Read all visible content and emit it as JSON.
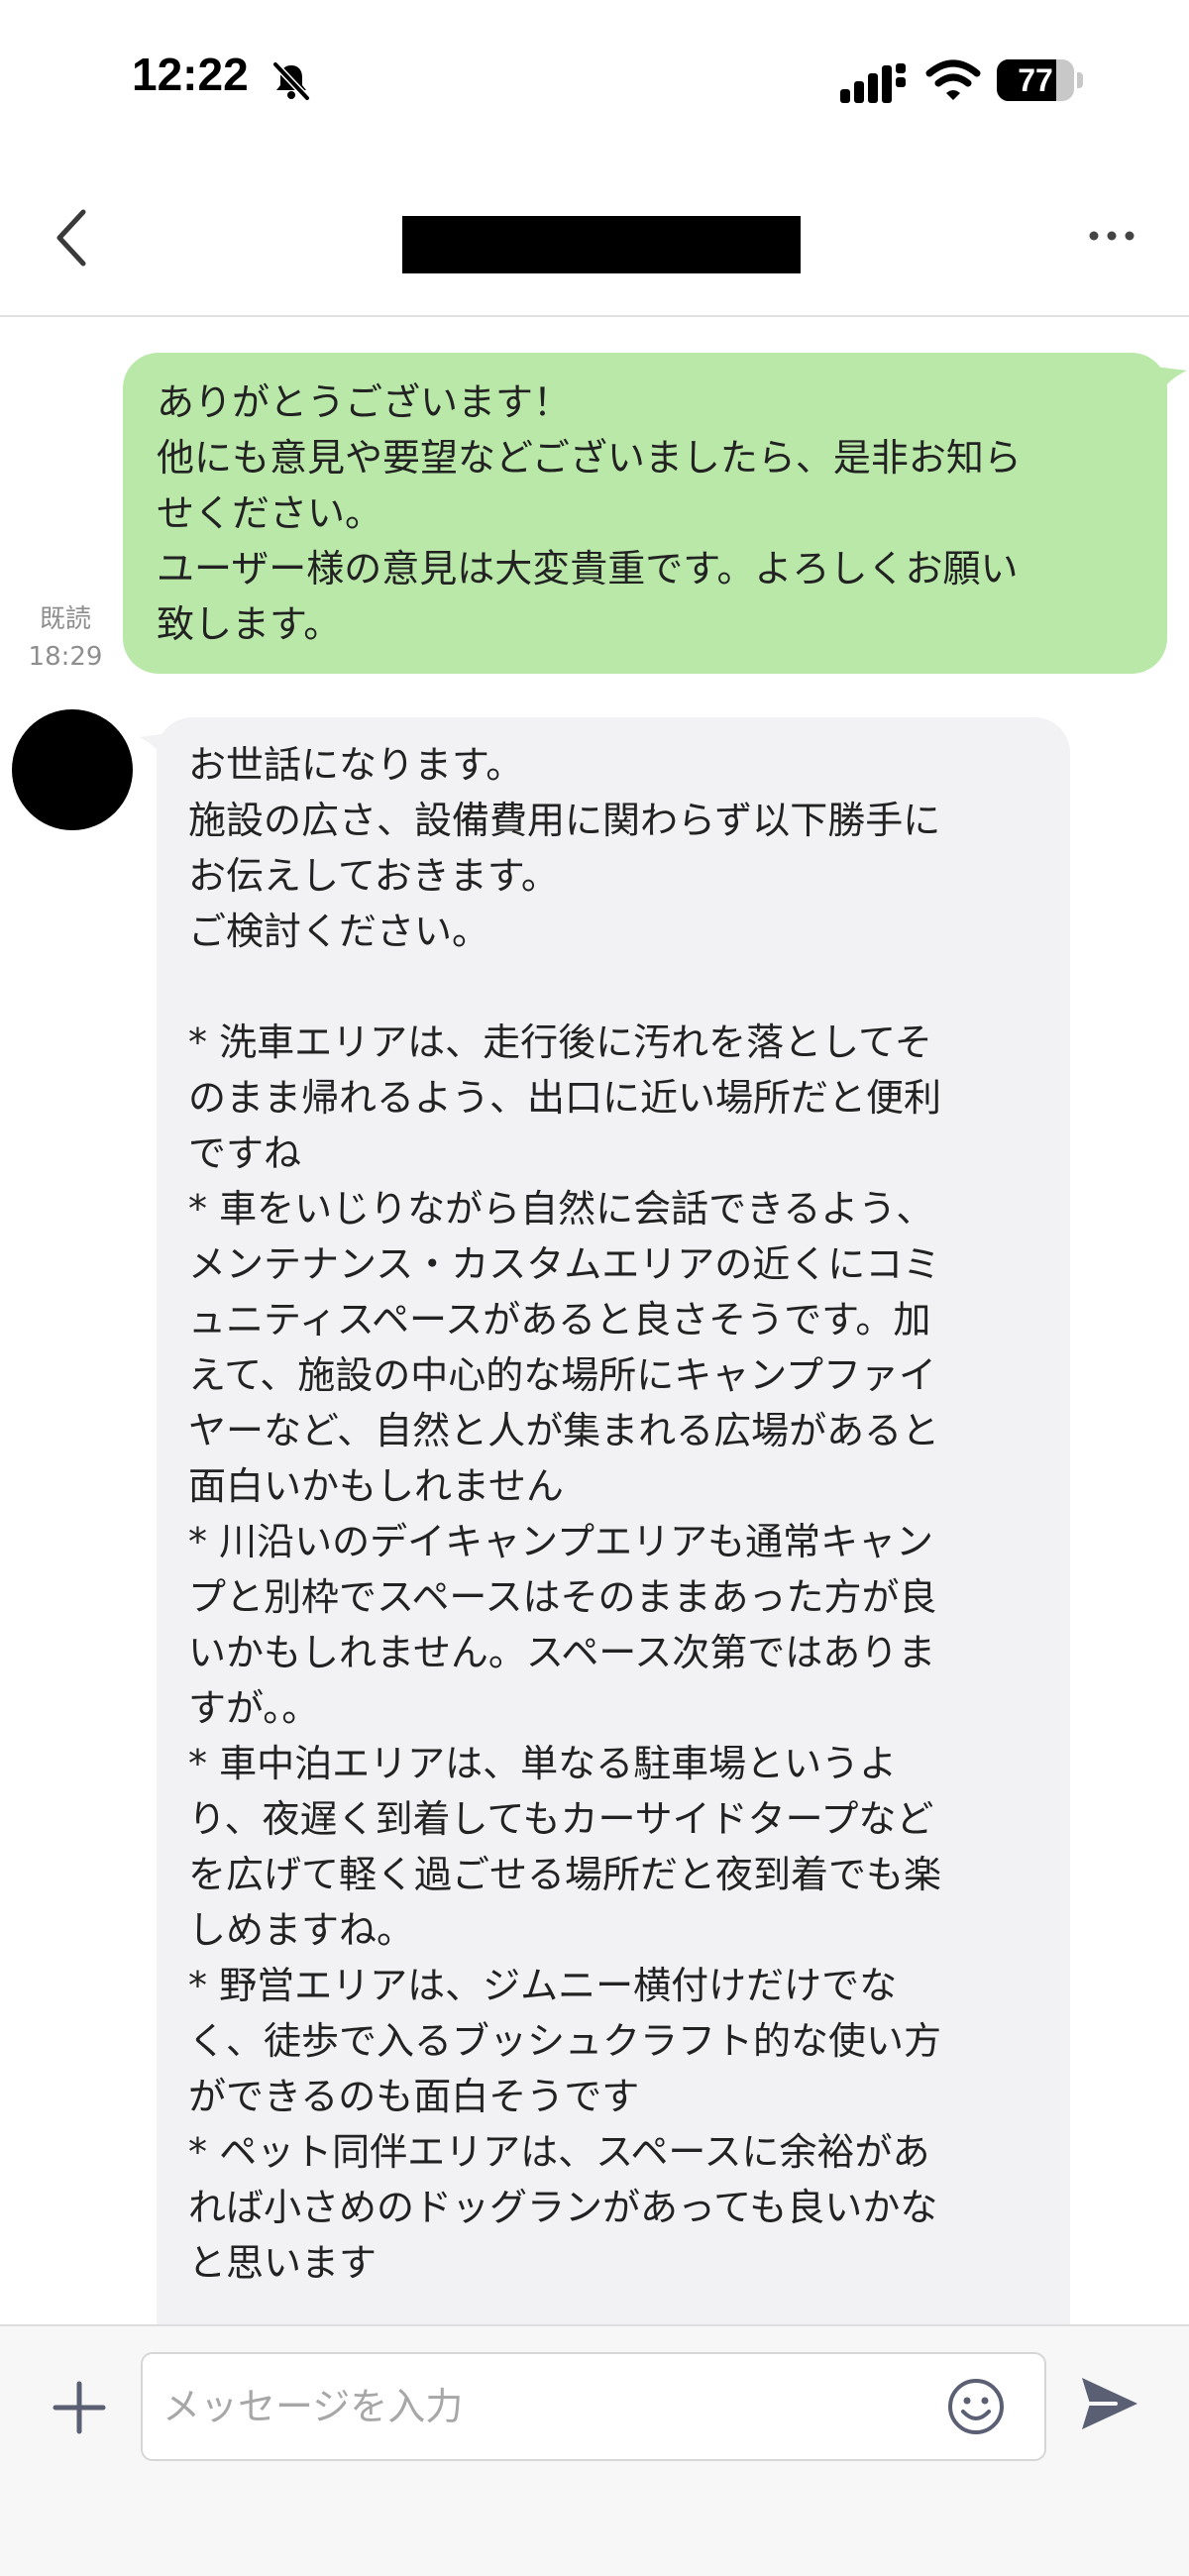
{
  "status_bar": {
    "time": "12:22",
    "battery_level": "77",
    "battery_fraction": 0.77
  },
  "header": {
    "back_icon": "chevron-left-icon",
    "title_redacted": true,
    "more_icon": "more-horizontal-icon"
  },
  "messages": [
    {
      "direction": "outgoing",
      "text": "ありがとうございます！\n他にも意見や要望などございましたら、是非お知ら\nせください。\nユーザー様の意見は大変貴重です。よろしくお願い\n致します。",
      "read_label": "既読",
      "time": "18:29"
    },
    {
      "direction": "incoming",
      "text": "お世話になります。\n施設の広さ、設備費用に関わらず以下勝手に\nお伝えしておきます。\nご検討ください。\n\n* 洗車エリアは、走行後に汚れを落としてそ\nのまま帰れるよう、出口に近い場所だと便利\nですね\n* 車をいじりながら自然に会話できるよう、\nメンテナンス・カスタムエリアの近くにコミ\nュニティスペースがあると良さそうです。加\nえて、施設の中心的な場所にキャンプファイ\nヤーなど、自然と人が集まれる広場があると\n面白いかもしれません\n* 川沿いのデイキャンプエリアも通常キャン\nプと別枠でスペースはそのままあった方が良\nいかもしれません。スペース次第ではありま\nすが。。\n* 車中泊エリアは、単なる駐車場というよ\nり、夜遅く到着してもカーサイドタープなど\nを広げて軽く過ごせる場所だと夜到着でも楽\nしめますね。\n* 野営エリアは、ジムニー横付けだけでな\nく、徒歩で入るブッシュクラフト的な使い方\nができるのも面白そうです\n* ペット同伴エリアは、スペースに余裕があ\nれば小さめのドッグランがあっても良いかな\nと思います"
    }
  ],
  "input_bar": {
    "placeholder": "メッセージを入力",
    "add_icon": "plus-icon",
    "emoji_icon": "smiley-icon",
    "send_icon": "send-icon"
  },
  "colors": {
    "outgoing_bubble": "#b9e8a9",
    "incoming_bubble": "#f2f1f4",
    "icon_gray": "#5b5f73",
    "timestamp": "#8e8e8e"
  }
}
